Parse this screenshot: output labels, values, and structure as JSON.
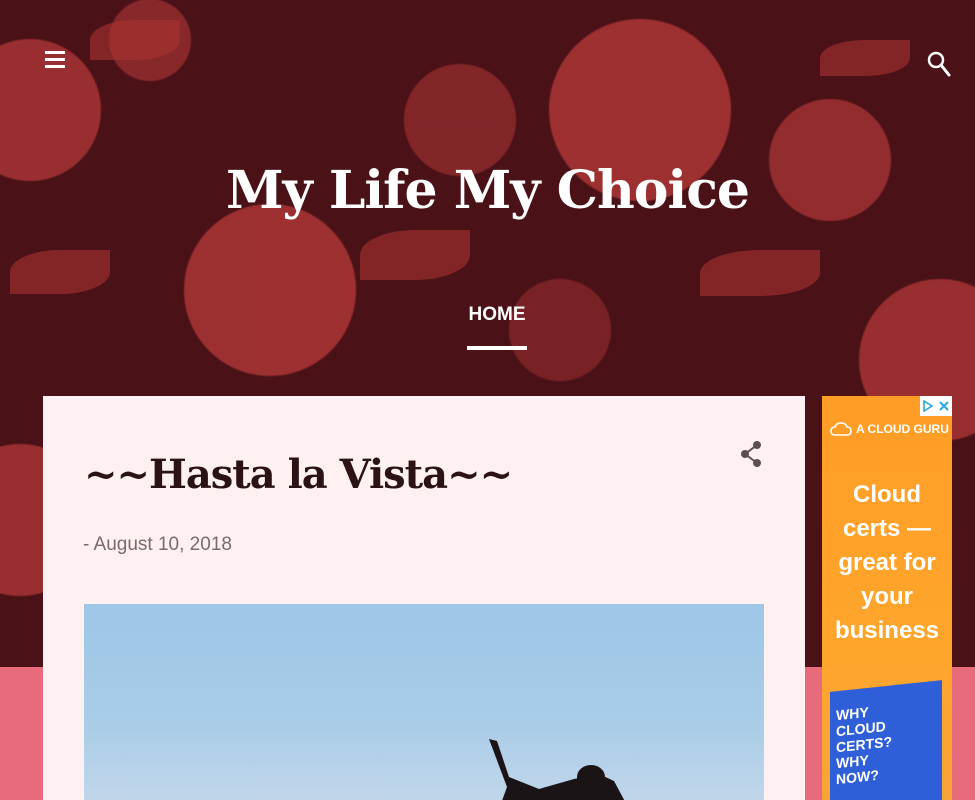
{
  "header": {
    "site_title": "My Life My Choice",
    "nav": [
      {
        "label": "HOME",
        "active": true
      }
    ]
  },
  "post": {
    "title": "~~Hasta la Vista~~",
    "date": "- August 10, 2018"
  },
  "ad": {
    "brand": "A CLOUD GURU",
    "headline": "Cloud certs — great for your business",
    "book_text": "WHY CLOUD CERTS? WHY NOW?"
  },
  "icons": {
    "menu": "menu-icon",
    "search": "search-icon",
    "share": "share-icon",
    "ad_close": "close-icon",
    "ad_info": "adchoices-icon"
  },
  "colors": {
    "header_background": "#4a1117",
    "floral_accent": "#b23737",
    "page_background": "#e86b7b",
    "card_background": "#fff1f1",
    "ad_background": "#ff9d26"
  }
}
